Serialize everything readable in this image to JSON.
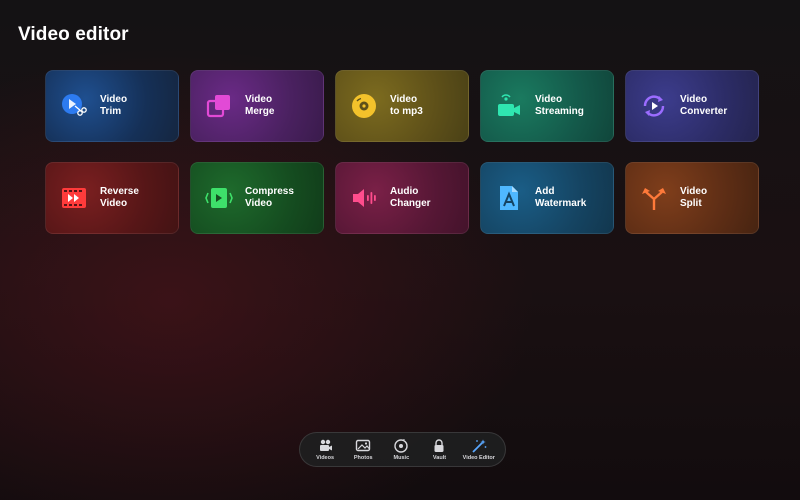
{
  "page": {
    "title": "Video editor"
  },
  "tools": [
    {
      "line1": "Video",
      "line2": "Trim",
      "icon": "trim-icon",
      "color": "#2d7bf0"
    },
    {
      "line1": "Video",
      "line2": "Merge",
      "icon": "merge-icon",
      "color": "#e24ad6"
    },
    {
      "line1": "Video",
      "line2": "to mp3",
      "icon": "disc-icon",
      "color": "#f3c22b"
    },
    {
      "line1": "Video",
      "line2": "Streaming",
      "icon": "stream-camera-icon",
      "color": "#2fe6b0"
    },
    {
      "line1": "Video",
      "line2": "Converter",
      "icon": "convert-icon",
      "color": "#9b6cff"
    },
    {
      "line1": "Reverse",
      "line2": "Video",
      "icon": "reverse-film-icon",
      "color": "#ff3b3b"
    },
    {
      "line1": "Compress",
      "line2": "Video",
      "icon": "compress-icon",
      "color": "#3ee06a"
    },
    {
      "line1": "Audio",
      "line2": "Changer",
      "icon": "speaker-icon",
      "color": "#ff4d8d"
    },
    {
      "line1": "Add",
      "line2": "Watermark",
      "icon": "watermark-file-icon",
      "color": "#4fb8ff"
    },
    {
      "line1": "Video",
      "line2": "Split",
      "icon": "split-arrows-icon",
      "color": "#ff7a3a"
    }
  ],
  "tabbar": {
    "tabs": [
      {
        "label": "Videos",
        "icon": "videos-icon"
      },
      {
        "label": "Photos",
        "icon": "photos-icon"
      },
      {
        "label": "Music",
        "icon": "music-icon"
      },
      {
        "label": "Vault",
        "icon": "lock-icon"
      },
      {
        "label": "Video Editor",
        "icon": "magic-wand-icon"
      }
    ]
  }
}
